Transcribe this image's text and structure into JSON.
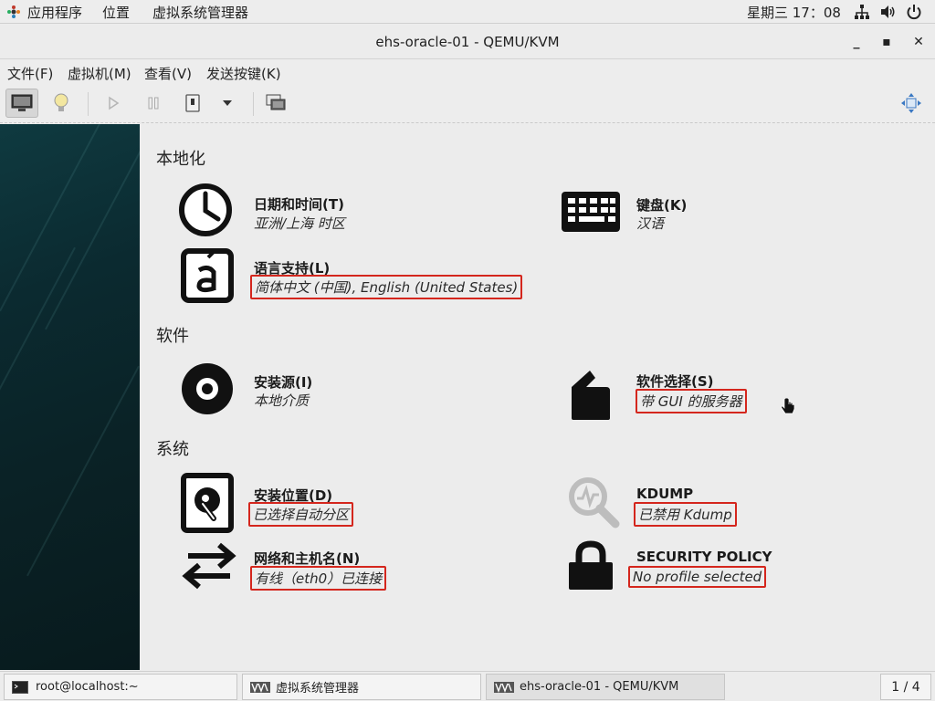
{
  "top_panel": {
    "applications": "应用程序",
    "places": "位置",
    "app_name": "虚拟系统管理器",
    "clock": "星期三 17：08"
  },
  "window": {
    "title": "ehs-oracle-01 - QEMU/KVM",
    "minimize": "_",
    "maximize": "▪",
    "close": "✕"
  },
  "menu": {
    "file": "文件(F)",
    "vm": "虚拟机(M)",
    "view": "查看(V)",
    "send_key": "发送按键(K)"
  },
  "installer": {
    "localization_title": "本地化",
    "software_title": "软件",
    "system_title": "系统",
    "spokes": {
      "datetime": {
        "title": "日期和时间(T)",
        "status": "亚洲/上海 时区"
      },
      "keyboard": {
        "title": "键盘(K)",
        "status": "汉语"
      },
      "language": {
        "title": "语言支持(L)",
        "status": "简体中文 (中国), English (United States)"
      },
      "source": {
        "title": "安装源(I)",
        "status": "本地介质"
      },
      "software": {
        "title": "软件选择(S)",
        "status": "带 GUI 的服务器"
      },
      "destination": {
        "title": "安装位置(D)",
        "status": "已选择自动分区"
      },
      "kdump": {
        "title": "KDUMP",
        "status": "已禁用 Kdump"
      },
      "network": {
        "title": "网络和主机名(N)",
        "status": "有线（eth0）已连接"
      },
      "security": {
        "title": "SECURITY POLICY",
        "status": "No profile selected"
      }
    }
  },
  "taskbar": {
    "terminal": "root@localhost:~",
    "virt_manager": "虚拟系统管理器",
    "vm_window": "ehs-oracle-01 - QEMU/KVM",
    "workspace": "1 / 4"
  },
  "colors": {
    "highlight_box": "#d4261d",
    "sidebar": "#0b2a30"
  }
}
